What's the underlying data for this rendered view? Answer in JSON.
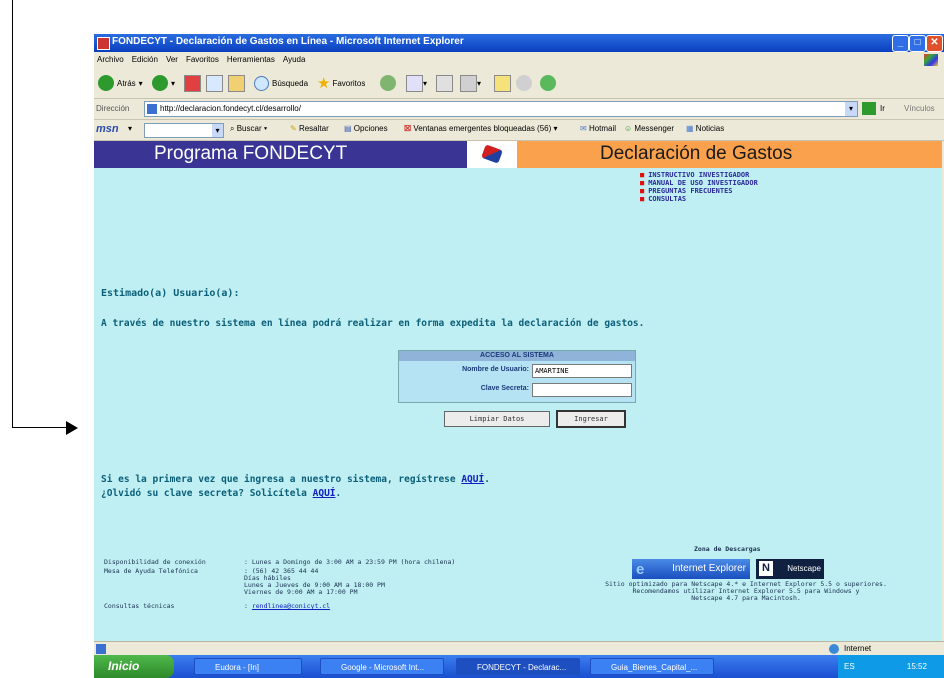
{
  "window": {
    "title": "FONDECYT - Declaración de Gastos en Línea - Microsoft Internet Explorer"
  },
  "menu": [
    "Archivo",
    "Edición",
    "Ver",
    "Favoritos",
    "Herramientas",
    "Ayuda"
  ],
  "toolbar": {
    "back": "Atrás",
    "search": "Búsqueda",
    "favorites": "Favoritos"
  },
  "address": {
    "label": "Dirección",
    "url": "http://declaracion.fondecyt.cl/desarrollo/",
    "go": "Ir",
    "links": "Vínculos"
  },
  "msn": {
    "logo": "msn",
    "buscar": "Buscar",
    "resaltar": "Resaltar",
    "opciones": "Opciones",
    "popups": "Ventanas emergentes bloqueadas (56)",
    "hotmail": "Hotmail",
    "messenger": "Messenger",
    "noticias": "Noticias"
  },
  "banner": {
    "left": "Programa FONDECYT",
    "right": "Declaración de Gastos"
  },
  "links": [
    "INSTRUCTIVO INVESTIGADOR",
    "MANUAL DE USO INVESTIGADOR",
    "PREGUNTAS FRECUENTES",
    "CONSULTAS"
  ],
  "greeting": "Estimado(a) Usuario(a):",
  "intro": "A través de nuestro sistema en línea podrá realizar en forma expedita la declaración de gastos.",
  "login": {
    "header": "ACCESO AL SISTEMA",
    "user_label": "Nombre de Usuario:",
    "user_value": "AMARTINE",
    "pass_label": "Clave Secreta:",
    "pass_value": "",
    "clear_button": "Limpiar Datos",
    "submit_button": "Ingresar"
  },
  "register": {
    "line1_prefix": "Si es la primera vez que ingresa a nuestro sistema, regístrese ",
    "line1_link": "AQUÍ",
    "line1_suffix": ".",
    "line2_prefix": "¿Olvidó su clave secreta? Solicítela ",
    "line2_link": "AQUÍ",
    "line2_suffix": "."
  },
  "footer": {
    "availability_label": "Disponibilidad de conexión",
    "availability_value": ": Lunes a Domingo de 3:00 AM a 23:59 PM (hora chilena)",
    "helpdesk_label": "Mesa de Ayuda Telefónica",
    "helpdesk_lines": [
      ": (56) 42 365 44 44",
      "  Días hábiles",
      "  Lunes a Jueves de 9:00 AM a 18:00 PM",
      "  Viernes de 9:00 AM a 17:00 PM"
    ],
    "tech_label": "Consultas técnicas",
    "tech_colon": ": ",
    "tech_email": "rendlinea@conicyt.cl",
    "downloads_title": "Zona de Descargas",
    "ie_badge": "Internet Explorer",
    "ns_badge": "Netscape",
    "compat_lines": [
      "Sitio optimizado para Netscape 4.* e Internet Explorer 5.5 o superiores.",
      "Recomendamos utilizar Internet Explorer 5.5 para Windows y",
      "Netscape 4.7 para Macintosh."
    ]
  },
  "status": {
    "zone": "Internet"
  },
  "taskbar": {
    "start": "Inicio",
    "tasks": [
      "Eudora - [In]",
      "Google - Microsoft Int...",
      "FONDECYT - Declarac...",
      "Guia_Bienes_Capital_..."
    ],
    "lang": "ES",
    "time": "15:52"
  },
  "colors": {
    "banner_left": "#3a3595",
    "banner_right": "#f9a14d",
    "content_bg": "#bfeff3",
    "text_teal": "#0b5f78"
  }
}
